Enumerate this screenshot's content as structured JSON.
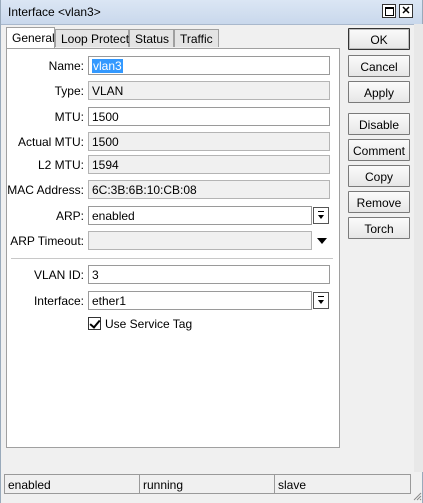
{
  "window": {
    "title": "Interface <vlan3>"
  },
  "tabs": [
    {
      "label": "General",
      "active": true
    },
    {
      "label": "Loop Protect",
      "active": false
    },
    {
      "label": "Status",
      "active": false
    },
    {
      "label": "Traffic",
      "active": false
    }
  ],
  "form": {
    "name": {
      "label": "Name:",
      "value": "vlan3"
    },
    "type": {
      "label": "Type:",
      "value": "VLAN"
    },
    "mtu": {
      "label": "MTU:",
      "value": "1500"
    },
    "actual_mtu": {
      "label": "Actual MTU:",
      "value": "1500"
    },
    "l2_mtu": {
      "label": "L2 MTU:",
      "value": "1594"
    },
    "mac_address": {
      "label": "MAC Address:",
      "value": "6C:3B:6B:10:CB:08"
    },
    "arp": {
      "label": "ARP:",
      "value": "enabled"
    },
    "arp_timeout": {
      "label": "ARP Timeout:",
      "value": ""
    },
    "vlan_id": {
      "label": "VLAN ID:",
      "value": "3"
    },
    "interface": {
      "label": "Interface:",
      "value": "ether1"
    },
    "use_service_tag": {
      "label": "Use Service Tag",
      "checked": true
    }
  },
  "buttons": {
    "ok": "OK",
    "cancel": "Cancel",
    "apply": "Apply",
    "disable": "Disable",
    "comment": "Comment",
    "copy": "Copy",
    "remove": "Remove",
    "torch": "Torch"
  },
  "status": {
    "enabled": "enabled",
    "running": "running",
    "slave": "slave"
  },
  "colors": {
    "titlebar": "#c9d8ec",
    "selection": "#3399ff"
  },
  "icons": {
    "restore": "restore-icon",
    "close": "close-icon",
    "dropdown": "chevron-down-icon",
    "check": "checkmark-icon"
  }
}
